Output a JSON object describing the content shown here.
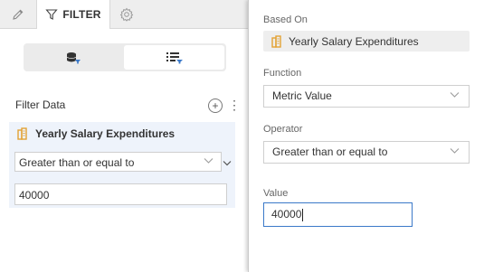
{
  "tabs": {
    "filter_label": "FILTER"
  },
  "left_panel": {
    "filter_data_title": "Filter Data",
    "add_symbol": "+",
    "more_symbol": "⋮",
    "card": {
      "title": "Yearly Salary Expenditures",
      "operator": "Greater than or equal to",
      "value": "40000"
    }
  },
  "right_panel": {
    "based_on_label": "Based On",
    "based_on_value": "Yearly Salary Expenditures",
    "function_label": "Function",
    "function_value": "Metric Value",
    "operator_label": "Operator",
    "operator_value": "Greater than or equal to",
    "value_label": "Value",
    "value_input": "40000"
  },
  "colors": {
    "accent": "#3b79c9",
    "metric_icon": "#e3a234",
    "card_bg": "#eef3fb"
  }
}
